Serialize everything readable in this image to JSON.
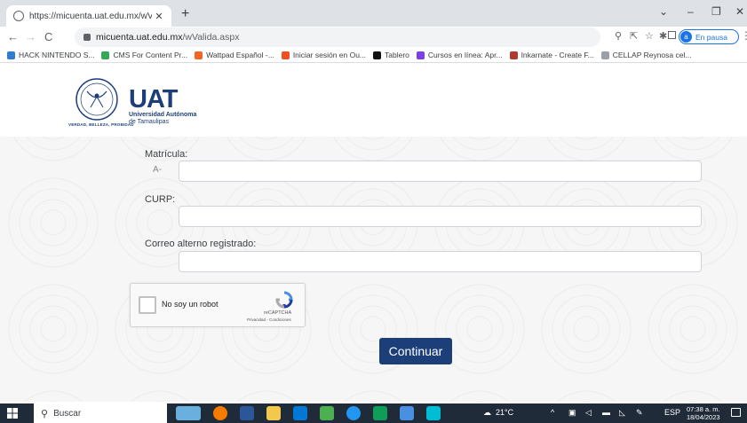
{
  "browser": {
    "tab_title": "https://micuenta.uat.edu.mx/wVa",
    "tab_close": "✕",
    "new_tab": "+",
    "url_host": "micuenta.uat.edu.mx",
    "url_path": "/wValida.aspx",
    "profile_initial": "a",
    "profile_status": "En pausa",
    "window_controls": {
      "minimize": "–",
      "restore": "❐",
      "close": "✕",
      "tabs_menu": "⌄"
    }
  },
  "bookmarks": [
    {
      "label": "HACK NINTENDO S...",
      "color": "#2f7dd1"
    },
    {
      "label": "CMS For Content Pr...",
      "color": "#34a853"
    },
    {
      "label": "Wattpad Español -...",
      "color": "#f26522"
    },
    {
      "label": "Iniciar sesión en Ou...",
      "color": "#f25022"
    },
    {
      "label": "Tablero",
      "color": "#111111"
    },
    {
      "label": "Cursos en línea: Apr...",
      "color": "#7b3fe4"
    },
    {
      "label": "Inkarnate - Create F...",
      "color": "#b03a2e"
    },
    {
      "label": "CELLAP Reynosa cel...",
      "color": "#9aa0a6"
    }
  ],
  "header": {
    "seal_motto": "VERDAD, BELLEZA, PROBIDAD",
    "logo_text": "UAT",
    "logo_line1": "Universidad Autónoma",
    "logo_line2": "de Tamaulipas"
  },
  "form": {
    "matricula_label": "Matrícula:",
    "matricula_prefix": "A-",
    "matricula_value": "",
    "curp_label": "CURP:",
    "curp_value": "",
    "correo_label": "Correo alterno registrado:",
    "correo_value": "",
    "recaptcha_label": "No soy un robot",
    "recaptcha_brand": "reCAPTCHA",
    "recaptcha_terms": "Privacidad - Condiciones",
    "submit_label": "Continuar"
  },
  "taskbar": {
    "search_placeholder": "Buscar",
    "weather": "21°C",
    "language": "ESP",
    "time": "07:38 a. m.",
    "date": "18/04/2023"
  },
  "colors": {
    "brand": "#1c3f7a",
    "taskbar": "#1f2b38",
    "page_bg": "#f6f6f6"
  }
}
